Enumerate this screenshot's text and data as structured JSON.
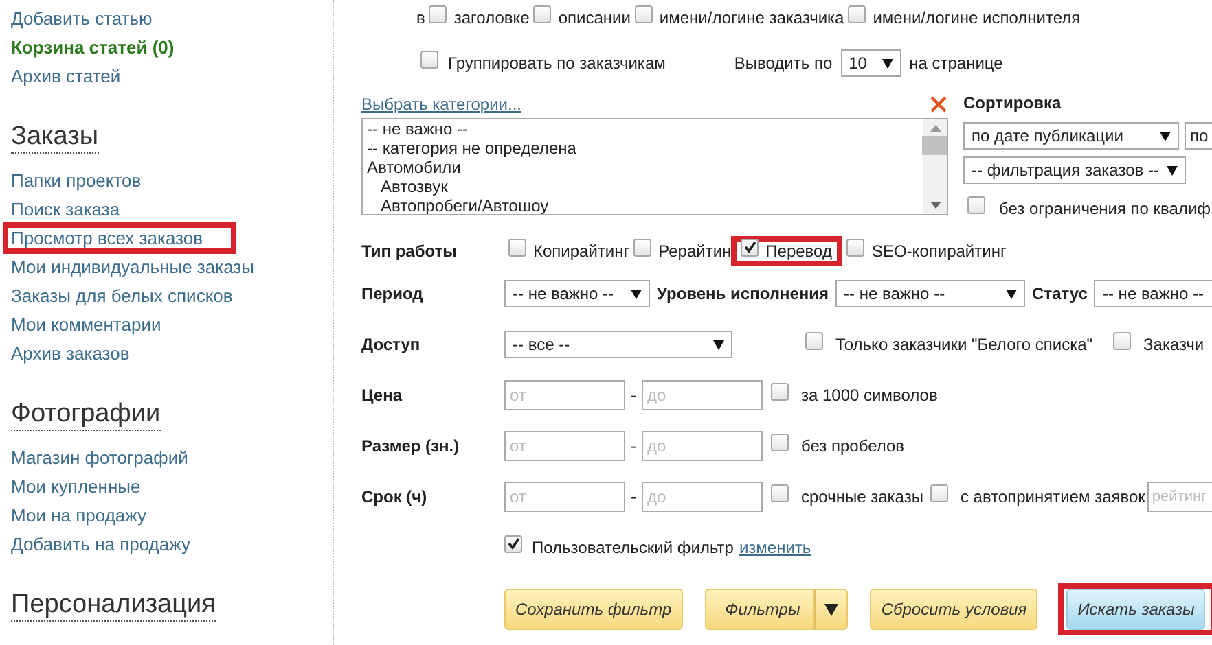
{
  "sidebar": {
    "links": [
      {
        "label": "Добавить статью",
        "emphasized": false
      },
      {
        "label": "Корзина статей (0)",
        "emphasized": true
      },
      {
        "label": "Архив статей",
        "emphasized": false
      }
    ],
    "sections": [
      {
        "title": "Заказы",
        "items": [
          {
            "label": "Папки проектов",
            "highlighted": false
          },
          {
            "label": "Поиск заказа",
            "highlighted": false
          },
          {
            "label": "Просмотр всех заказов",
            "highlighted": true
          },
          {
            "label": "Мои индивидуальные заказы",
            "highlighted": false
          },
          {
            "label": "Заказы для белых списков",
            "highlighted": false
          },
          {
            "label": "Мои комментарии",
            "highlighted": false
          },
          {
            "label": "Архив заказов",
            "highlighted": false
          }
        ]
      },
      {
        "title": "Фотографии",
        "items": [
          {
            "label": "Магазин фотографий",
            "highlighted": false
          },
          {
            "label": "Мои купленные",
            "highlighted": false
          },
          {
            "label": "Мои на продажу",
            "highlighted": false
          },
          {
            "label": "Добавить на продажу",
            "highlighted": false
          }
        ]
      },
      {
        "title": "Персонализация"
      }
    ]
  },
  "search_in": {
    "prefix": "в",
    "options": [
      {
        "label": "заголовке",
        "checked": false
      },
      {
        "label": "описании",
        "checked": false
      },
      {
        "label": "имени/логине заказчика",
        "checked": false
      },
      {
        "label": "имени/логине исполнителя",
        "checked": false
      }
    ]
  },
  "group_by_customers": {
    "label": "Группировать по заказчикам",
    "checked": false
  },
  "per_page": {
    "label": "Выводить по",
    "value": "10",
    "suffix": "на странице"
  },
  "categories": {
    "link": "Выбрать категории...",
    "options": [
      {
        "label": "-- не важно --"
      },
      {
        "label": "-- категория не определена"
      },
      {
        "label": "Автомобили",
        "children": [
          {
            "label": "Автозвук"
          },
          {
            "label": "Автопробеги/Автошоу"
          }
        ]
      }
    ]
  },
  "sorting": {
    "title": "Сортировка",
    "order": "по дате публикации",
    "direction": "по",
    "filter": "-- фильтрация заказов --",
    "unlimited": {
      "label": "без ограничения по квалиф",
      "checked": false
    }
  },
  "work_type": {
    "label": "Тип работы",
    "options": [
      {
        "label": "Копирайтинг",
        "checked": false,
        "highlighted": false
      },
      {
        "label": "Рерайтин",
        "checked": false,
        "highlighted": false
      },
      {
        "label": "Перевод",
        "checked": true,
        "highlighted": true
      },
      {
        "label": "SEO-копирайтинг",
        "checked": false,
        "highlighted": false
      }
    ]
  },
  "period_row": [
    {
      "label": "Период",
      "value": "-- не важно --"
    },
    {
      "label": "Уровень исполнения",
      "value": "-- не важно --"
    },
    {
      "label": "Статус",
      "value": "-- не важно --"
    }
  ],
  "access": {
    "label": "Доступ",
    "value": "-- все --",
    "options": [
      {
        "label": "Только заказчики \"Белого списка\"",
        "checked": false
      },
      {
        "label": "Заказчи",
        "checked": false
      }
    ]
  },
  "ranges": [
    {
      "label": "Цена",
      "from_placeholder": "от",
      "separator": "-",
      "to_placeholder": "до",
      "options": [
        {
          "label": "за 1000 символов",
          "checked": false
        }
      ]
    },
    {
      "label": "Размер (зн.)",
      "from_placeholder": "от",
      "separator": "-",
      "to_placeholder": "до",
      "options": [
        {
          "label": "без пробелов",
          "checked": false
        }
      ]
    },
    {
      "label": "Срок (ч)",
      "from_placeholder": "от",
      "separator": "-",
      "to_placeholder": "до",
      "options": [
        {
          "label": "срочные заказы",
          "checked": false
        },
        {
          "label": "с автопринятием заявок",
          "checked": false
        }
      ],
      "extra_placeholder": "рейтинг"
    }
  ],
  "custom_filter": {
    "label": "Пользовательский фильтр",
    "checked": true,
    "link": "изменить"
  },
  "buttons": [
    {
      "label": "Сохранить фильтр",
      "kind": "plain",
      "highlighted": false
    },
    {
      "label": "Фильтры",
      "kind": "split",
      "highlighted": false
    },
    {
      "label": "Сбросить условия",
      "kind": "plain",
      "highlighted": false
    },
    {
      "label": "Искать заказы",
      "kind": "primary",
      "highlighted": true
    }
  ]
}
